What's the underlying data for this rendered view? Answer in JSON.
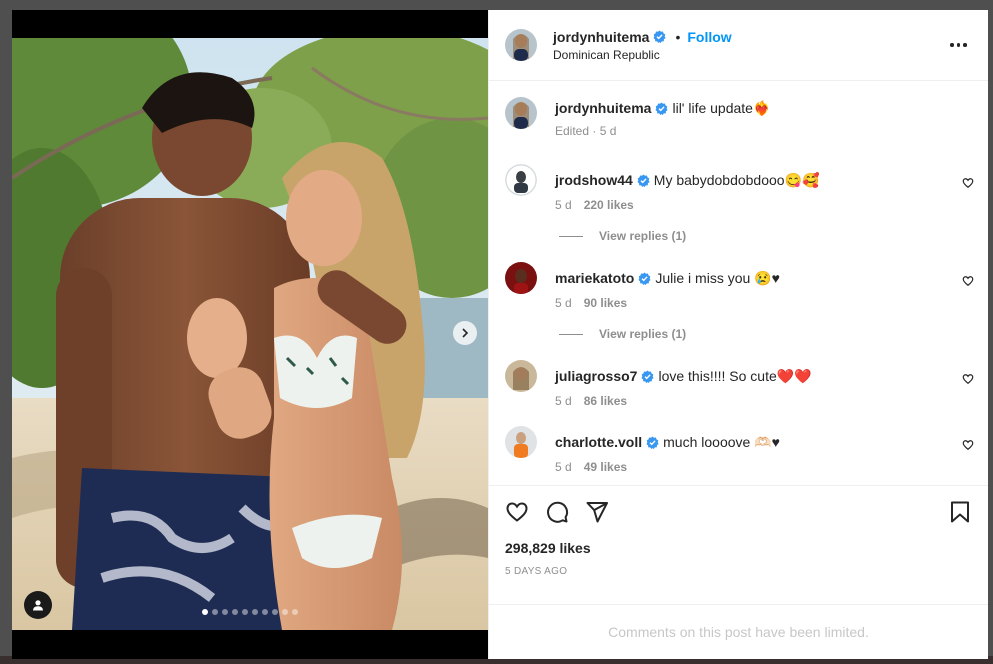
{
  "post": {
    "username": "jordynhuitema",
    "follow_label": "Follow",
    "separator": "•",
    "location": "Dominican Republic",
    "caption_user": "jordynhuitema",
    "caption_text": "lil' life update❤️‍🔥",
    "caption_meta": "Edited · 5 d",
    "likes_total": "298,829 likes",
    "date": "5 DAYS AGO",
    "limited_notice": "Comments on this post have been limited.",
    "carousel": {
      "slides": 10,
      "active_index": 0
    }
  },
  "comments": [
    {
      "user": "jrodshow44",
      "text": "My babydobdobdooo😋🥰",
      "time": "5 d",
      "likes": "220 likes",
      "replies_label": "View replies (1)"
    },
    {
      "user": "mariekatoto",
      "text": "Julie i miss you 😢♥",
      "time": "5 d",
      "likes": "90 likes",
      "replies_label": "View replies (1)"
    },
    {
      "user": "juliagrosso7",
      "text": "love this!!!! So cute❤️❤️",
      "time": "5 d",
      "likes": "86 likes"
    },
    {
      "user": "charlotte.voll",
      "text": "much loooove 🫶🏻♥",
      "time": "5 d",
      "likes": "49 likes"
    }
  ],
  "colors": {
    "accent": "#0095f6",
    "verified": "#3897f0",
    "muted": "#8e8e8e"
  },
  "icons": [
    "verified-badge-icon",
    "more-options-icon",
    "heart-icon",
    "comment-icon",
    "share-icon",
    "bookmark-icon",
    "chevron-right-icon",
    "user-tag-icon"
  ]
}
